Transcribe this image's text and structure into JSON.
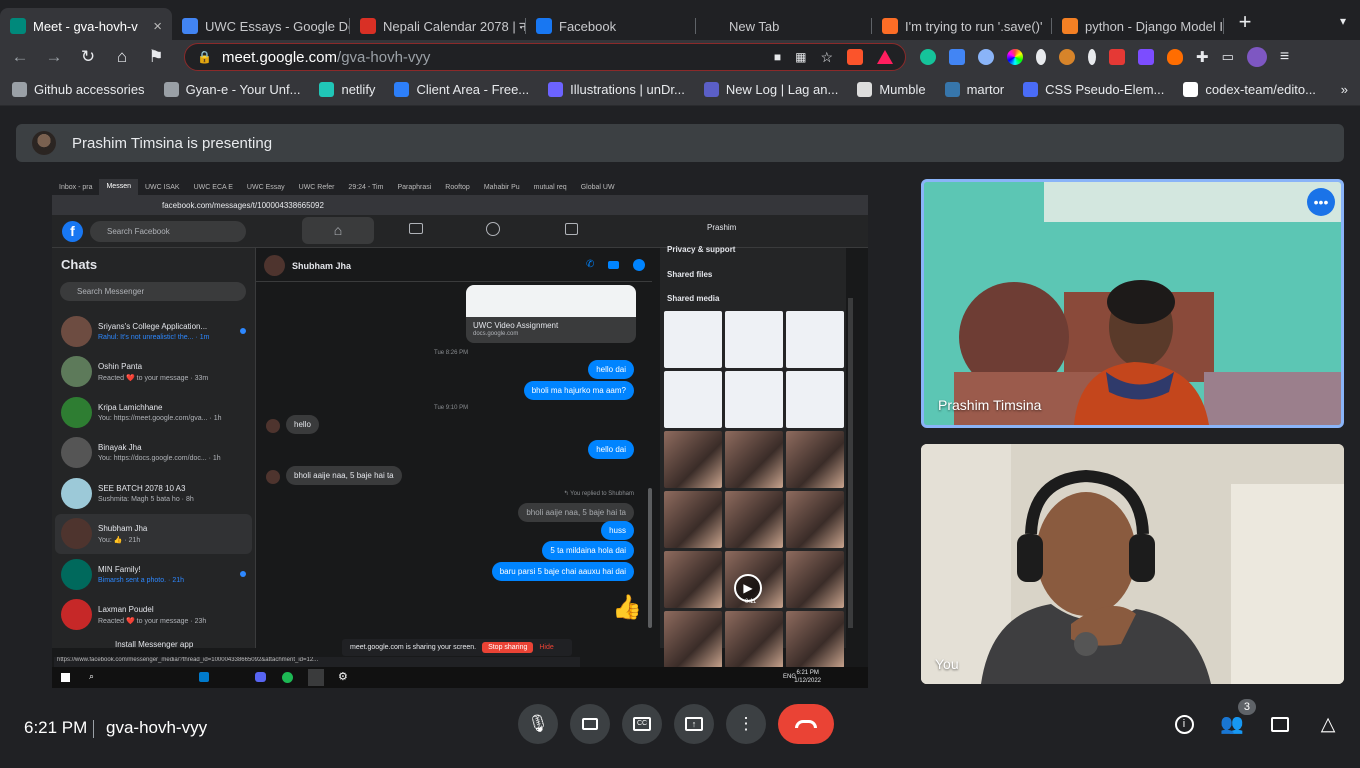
{
  "browser": {
    "tabs": [
      {
        "title": "Meet - gva-hovh-v",
        "icon": "google-meet-icon",
        "color": "#00897b",
        "active": true
      },
      {
        "title": "UWC Essays - Google Dc",
        "icon": "google-docs-icon",
        "color": "#4285f4"
      },
      {
        "title": "Nepali Calendar 2078 | न",
        "icon": "calendar-icon",
        "color": "#d93025"
      },
      {
        "title": "Facebook",
        "icon": "facebook-icon",
        "color": "#1877f2"
      },
      {
        "title": "New Tab",
        "icon": "none",
        "color": "#202124"
      },
      {
        "title": "I'm trying to run '.save()'",
        "icon": "gitlab-icon",
        "color": "#fc6d26"
      },
      {
        "title": "python - Django Model Ir",
        "icon": "stackoverflow-icon",
        "color": "#f48024"
      }
    ],
    "url_host": "meet.google.com",
    "url_path": "/gva-hovh-vyy",
    "bookmarks": [
      {
        "label": "Github accessories",
        "icon": "folder-icon",
        "color": "#9aa0a6"
      },
      {
        "label": "Gyan-e - Your Unf...",
        "icon": "globe-icon",
        "color": "#9aa0a6"
      },
      {
        "label": "netlify",
        "icon": "netlify-icon",
        "color": "#20c6b7"
      },
      {
        "label": "Client Area - Free...",
        "icon": "in-icon",
        "color": "#2d7ff9"
      },
      {
        "label": "Illustrations | unDr...",
        "icon": "undraw-icon",
        "color": "#6c63ff"
      },
      {
        "label": "New Log | Lag an...",
        "icon": "log-icon",
        "color": "#5b5fc7"
      },
      {
        "label": "Mumble",
        "icon": "mumble-icon",
        "color": "#dddddd"
      },
      {
        "label": "martor",
        "icon": "python-icon",
        "color": "#3776ab"
      },
      {
        "label": "CSS Pseudo-Elem...",
        "icon": "flag-icon",
        "color": "#4a6cf7"
      },
      {
        "label": "codex-team/edito...",
        "icon": "github-icon",
        "color": "#ffffff"
      }
    ]
  },
  "meet": {
    "presenting_text": "Prashim Timsina is presenting",
    "participants": [
      {
        "name": "Prashim Timsina"
      },
      {
        "name": "You"
      }
    ],
    "time": "6:21 PM",
    "meeting_code": "gva-hovh-vyy",
    "people_count": "3"
  },
  "screen_share": {
    "tabs": [
      "Inbox - pra",
      "Messen",
      "UWC ISAK",
      "UWC ECA E",
      "UWC Essay",
      "UWC Refer",
      "29:24 - Tim",
      "Paraphrasi",
      "Rooftop",
      "Mahabir Pu",
      "mutual req",
      "Global UW"
    ],
    "url": "facebook.com/messages/t/100004338665092",
    "search_placeholder": "Search Facebook",
    "profile_name": "Prashim",
    "chats_title": "Chats",
    "messenger_search": "Search Messenger",
    "chats": [
      {
        "name": "Sriyans's College Application...",
        "preview": "Rahul: It's not unrealistic! the... · 1m",
        "unread": true,
        "color": "#6d4c41"
      },
      {
        "name": "Oshin Panta",
        "preview": "Reacted ❤️ to your message · 33m",
        "color": "#5d7a5a"
      },
      {
        "name": "Kripa Lamichhane",
        "preview": "You: https://meet.google.com/gva... · 1h",
        "color": "#2e7d32"
      },
      {
        "name": "Binayak Jha",
        "preview": "You: https://docs.google.com/doc... · 1h",
        "color": "#555555"
      },
      {
        "name": "SEE BATCH 2078 10 A3",
        "preview": "Sushmita: Magh 5 bata ho · 8h",
        "color": "#9cc9d8"
      },
      {
        "name": "Shubham Jha",
        "preview": "You: 👍 · 21h",
        "color": "#4e342e",
        "selected": true
      },
      {
        "name": "MIN Family!",
        "preview": "Bimarsh sent a photo. · 21h",
        "unread": true,
        "color": "#00695c"
      },
      {
        "name": "Laxman Poudel",
        "preview": "Reacted ❤️ to your message · 23h",
        "color": "#c62828"
      }
    ],
    "install_app": "Install Messenger app",
    "conversation_name": "Shubham Jha",
    "link_card_title": "UWC Video Assignment",
    "link_card_domain": "docs.google.com",
    "timestamp_1": "Tue 8:26 PM",
    "timestamp_2": "Tue 9:10 PM",
    "messages": [
      {
        "text": "hello dai",
        "from": "me"
      },
      {
        "text": "bholi ma hajurko ma aam?",
        "from": "me"
      },
      {
        "text": "hello",
        "from": "them"
      },
      {
        "text": "hello dai",
        "from": "me"
      },
      {
        "text": "bholi aaije naa, 5 baje hai ta",
        "from": "them"
      },
      {
        "text": "bholi aaije naa, 5 baje hai ta",
        "from": "quoted"
      },
      {
        "text": "huss",
        "from": "me"
      },
      {
        "text": "5 ta mildaina hola dai",
        "from": "me"
      },
      {
        "text": "baru parsi 5 baje chai aauxu hai dai",
        "from": "me"
      }
    ],
    "replied_label": "↰ You replied to Shubham",
    "info_sections": [
      "Privacy & support",
      "Shared files",
      "Shared media"
    ],
    "video_duration": "0:11",
    "sharing_text": "meet.google.com is sharing your screen.",
    "stop_sharing": "Stop sharing",
    "hide": "Hide",
    "status_url": "https://www.facebook.com/messenger_media/?thread_id=100004338665092&attachment_id=12...",
    "taskbar_time": "6:21 PM",
    "taskbar_date": "1/12/2022",
    "taskbar_lang": "ENG"
  },
  "colors": {
    "accent": "#8ab4f8",
    "end_call": "#ea4335",
    "messenger_blue": "#0084ff"
  }
}
